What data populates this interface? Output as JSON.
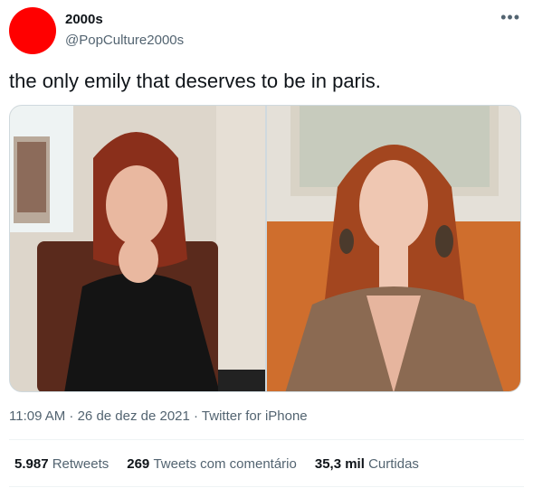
{
  "author": {
    "name": "2000s",
    "handle": "@PopCulture2000s",
    "avatar_color": "#ff0000"
  },
  "menu_icon": "more-horizontal-icon",
  "tweet": {
    "text": "the only emily that deserves to be in paris."
  },
  "meta": {
    "timestamp": "11:09 AM · 26 de dez de 2021 · Twitter for iPhone"
  },
  "stats": {
    "retweets_count": "5.987",
    "retweets_label": "Retweets",
    "quotes_count": "269",
    "quotes_label": "Tweets com comentário",
    "likes_count": "35,3 mil",
    "likes_label": "Curtidas"
  }
}
